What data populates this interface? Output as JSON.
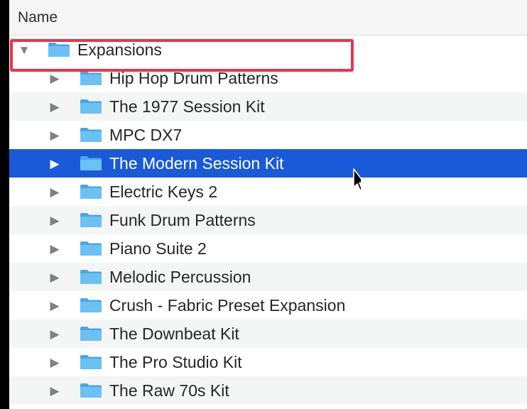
{
  "header": {
    "name_label": "Name"
  },
  "parent_folder": {
    "label": "Expansions",
    "expanded": true
  },
  "folders": [
    {
      "label": "Hip Hop Drum Patterns"
    },
    {
      "label": "The 1977 Session Kit"
    },
    {
      "label": "MPC DX7"
    },
    {
      "label": "The Modern Session Kit",
      "selected": true
    },
    {
      "label": "Electric Keys 2"
    },
    {
      "label": "Funk Drum Patterns"
    },
    {
      "label": "Piano Suite 2"
    },
    {
      "label": "Melodic Percussion"
    },
    {
      "label": "Crush - Fabric Preset Expansion"
    },
    {
      "label": "The Downbeat Kit"
    },
    {
      "label": "The Pro Studio Kit"
    },
    {
      "label": "The Raw 70s Kit"
    }
  ],
  "colors": {
    "selection": "#1a5ad8",
    "folder": "#5fb7f0",
    "highlight_border": "#e8344a"
  },
  "icons": {
    "disclosure_expanded": "triangle-down-icon",
    "disclosure_collapsed": "triangle-right-icon",
    "folder": "folder-icon",
    "cursor": "mouse-pointer-icon"
  }
}
